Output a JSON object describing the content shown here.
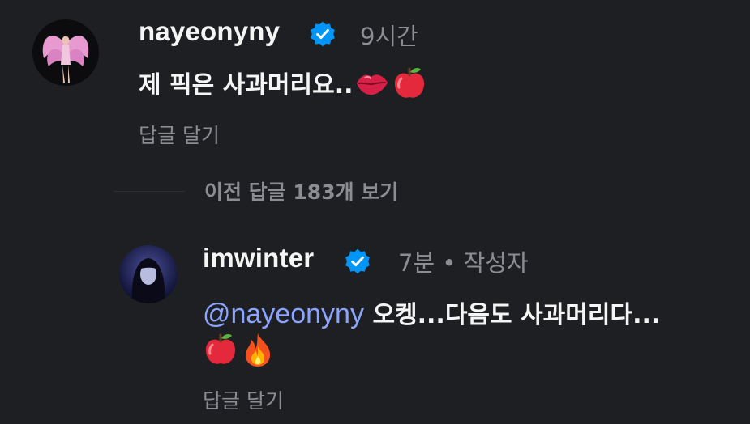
{
  "comment1": {
    "username": "nayeonyny",
    "time": "9시간",
    "text": "제 픽은 사과머리요..",
    "emojis": [
      "lips-icon",
      "apple-icon"
    ],
    "reply_label": "답글 달기"
  },
  "view_previous": {
    "label": "이전 답글 183개 보기"
  },
  "comment2": {
    "username": "imwinter",
    "time": "7분 • 작성자",
    "mention": "@nayeonyny",
    "text_line1": "오켕...다음도 사과머리다...",
    "emojis": [
      "apple-icon",
      "fire-icon"
    ],
    "reply_label": "답글 달기"
  },
  "colors": {
    "background": "#1e1f23",
    "text": "#f5f5f5",
    "muted": "#8b8d92",
    "mention": "#8aa4ff",
    "verified": "#0095f6"
  }
}
